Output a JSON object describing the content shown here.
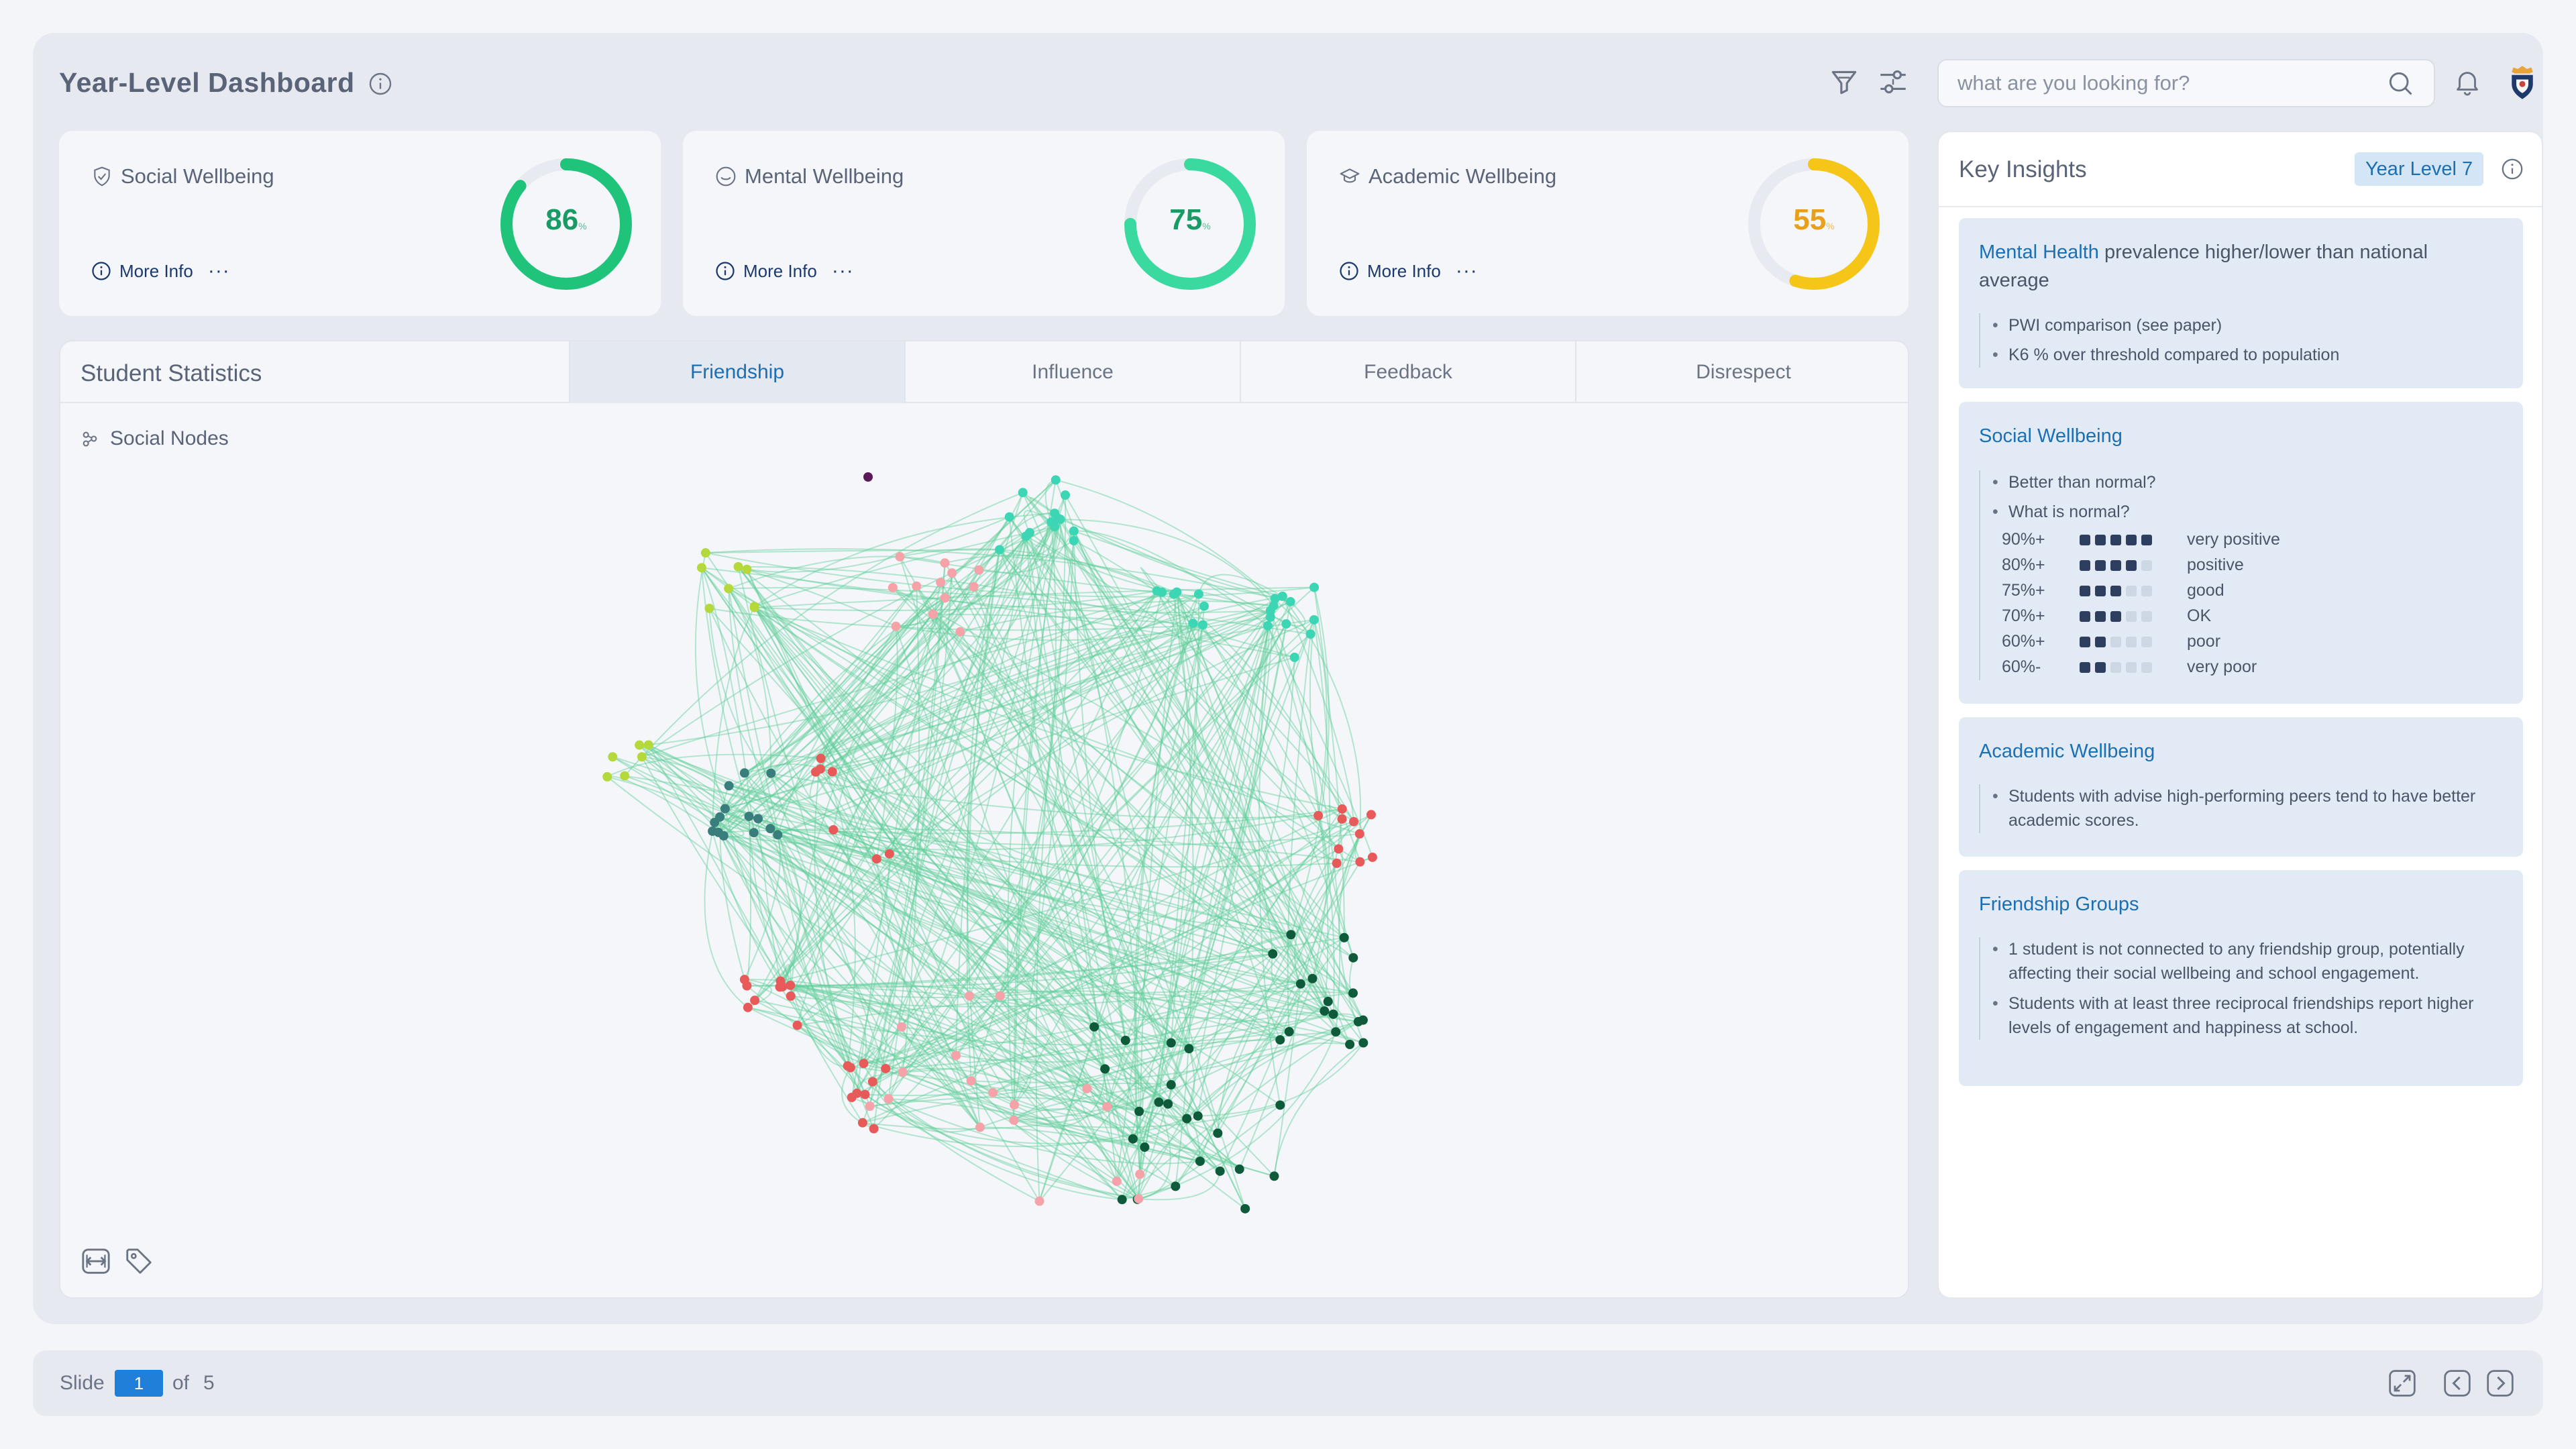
{
  "header": {
    "title": "Year-Level Dashboard",
    "search_placeholder": "what are you looking for?"
  },
  "cards": [
    {
      "title": "Social Wellbeing",
      "value": "86",
      "unit": "%",
      "fraction": 0.86,
      "color": "#1fc47a",
      "more": "More Info",
      "icon": "shield-check-icon"
    },
    {
      "title": "Mental Wellbeing",
      "value": "75",
      "unit": "%",
      "fraction": 0.75,
      "color": "#39d9a0",
      "more": "More Info",
      "icon": "smile-icon"
    },
    {
      "title": "Academic Wellbeing",
      "value": "55",
      "unit": "%",
      "fraction": 0.55,
      "color": "#f5c518",
      "more": "More Info",
      "icon": "graduation-cap-icon"
    }
  ],
  "stats": {
    "title": "Student Statistics",
    "tabs": [
      "Friendship",
      "Influence",
      "Feedback",
      "Disrespect"
    ],
    "active_tab": "Friendship",
    "section_label": "Social Nodes"
  },
  "insights": {
    "title": "Key Insights",
    "badge": "Year Level 7",
    "mental": {
      "highlight": "Mental Health",
      "rest": "prevalence higher/lower than national average",
      "bullets": [
        "PWI comparison (see paper)",
        "K6 % over threshold compared to population"
      ]
    },
    "social": {
      "title": "Social Wellbeing",
      "bullets": [
        "Better than normal?",
        "What is normal?"
      ],
      "scale": [
        {
          "pct": "90%+",
          "level": 5,
          "label": "very positive"
        },
        {
          "pct": "80%+",
          "level": 4,
          "label": "positive"
        },
        {
          "pct": "75%+",
          "level": 3,
          "label": "good"
        },
        {
          "pct": "70%+",
          "level": 3,
          "label": "OK"
        },
        {
          "pct": "60%+",
          "level": 2,
          "label": "poor"
        },
        {
          "pct": "60%-",
          "level": 2,
          "label": "very poor"
        }
      ]
    },
    "academic": {
      "title": "Academic Wellbeing",
      "bullets": [
        "Students with advise high-performing peers tend to have better academic scores."
      ]
    },
    "friendship": {
      "title": "Friendship Groups",
      "bullets": [
        "1 student is not connected to any friendship group, potentially affecting their social wellbeing and school engagement.",
        "Students with at least three reciprocal friendships report higher levels of engagement and happiness at school."
      ]
    }
  },
  "footer": {
    "slide_label": "Slide",
    "current": "1",
    "of": "of",
    "total": "5"
  },
  "colors": {
    "accent": "#1a6fb5",
    "edge": "#5fcf9a",
    "node_teal": "#3dd6b5",
    "node_lime": "#b5d93a",
    "node_pink": "#f5a3a8",
    "node_red": "#e85a5a",
    "node_dark": "#0f5a3a",
    "node_slate": "#3a7d7d"
  }
}
